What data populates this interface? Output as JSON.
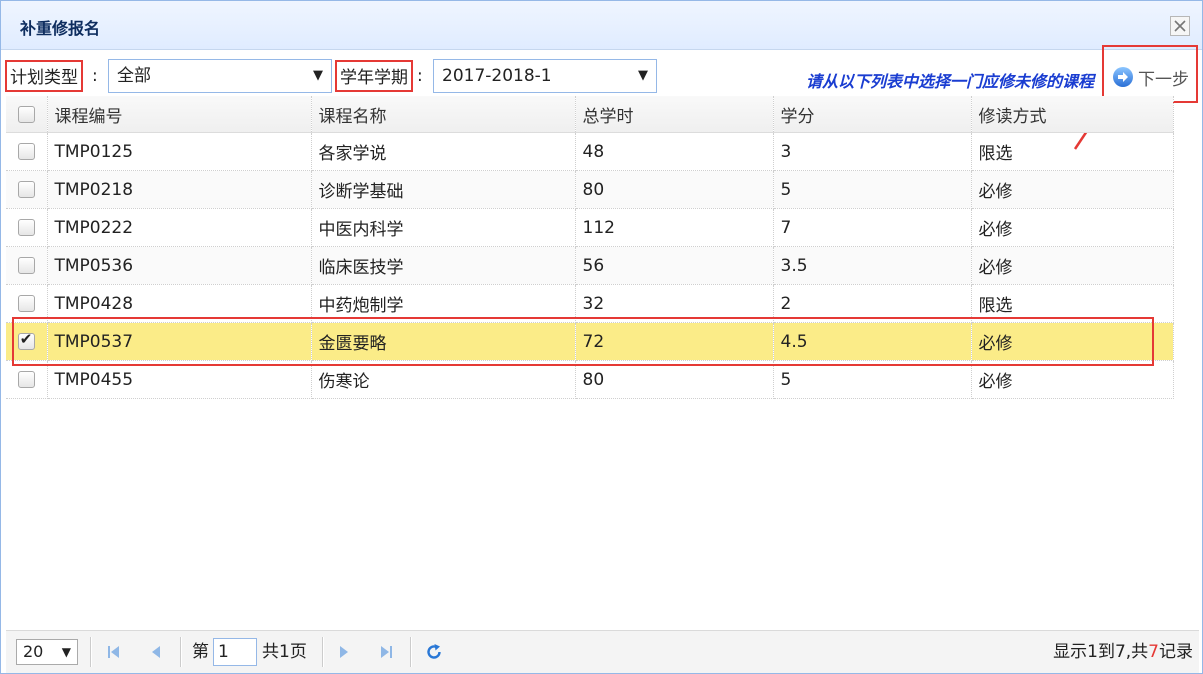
{
  "dialog": {
    "title": "补重修报名"
  },
  "filters": {
    "plan_type_label": "计划类型",
    "plan_type_value": "全部",
    "term_label": "学年学期",
    "term_value": "2017-2018-1",
    "colon": ":"
  },
  "hint": "请从以下列表中选择一门应修未修的课程",
  "next_label": "下一步",
  "table": {
    "headers": [
      "课程编号",
      "课程名称",
      "总学时",
      "学分",
      "修读方式"
    ],
    "rows": [
      {
        "code": "TMP0125",
        "name": "各家学说",
        "hours": "48",
        "credits": "3",
        "mode": "限选",
        "checked": false
      },
      {
        "code": "TMP0218",
        "name": "诊断学基础",
        "hours": "80",
        "credits": "5",
        "mode": "必修",
        "checked": false
      },
      {
        "code": "TMP0222",
        "name": "中医内科学",
        "hours": "112",
        "credits": "7",
        "mode": "必修",
        "checked": false
      },
      {
        "code": "TMP0536",
        "name": "临床医技学",
        "hours": "56",
        "credits": "3.5",
        "mode": "必修",
        "checked": false
      },
      {
        "code": "TMP0428",
        "name": "中药炮制学",
        "hours": "32",
        "credits": "2",
        "mode": "限选",
        "checked": false
      },
      {
        "code": "TMP0537",
        "name": "金匮要略",
        "hours": "72",
        "credits": "4.5",
        "mode": "必修",
        "checked": true
      },
      {
        "code": "TMP0455",
        "name": "伤寒论",
        "hours": "80",
        "credits": "5",
        "mode": "必修",
        "checked": false
      }
    ]
  },
  "pager": {
    "page_size": "20",
    "page_prefix": "第",
    "page_value": "1",
    "page_total": "共1页",
    "info_prefix": "显示1到7,共",
    "info_total": "7",
    "info_suffix": "记录"
  },
  "colors": {
    "accent": "#1a3dd1",
    "highlight": "#e53935",
    "selected_row": "#fbec88",
    "border": "#95b8e7"
  },
  "icons": [
    "close-icon",
    "next-arrow-icon",
    "first-page-icon",
    "prev-page-icon",
    "next-page-icon",
    "last-page-icon",
    "refresh-icon"
  ]
}
